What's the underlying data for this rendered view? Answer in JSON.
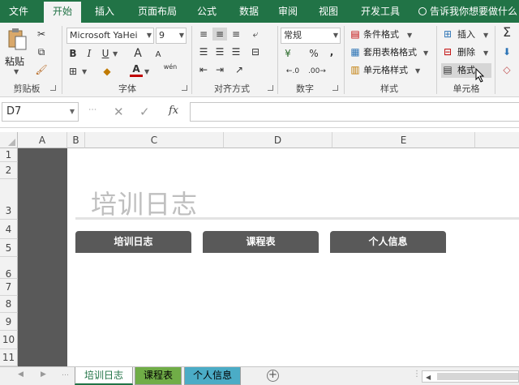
{
  "ribbon_tabs": [
    "文件",
    "开始",
    "插入",
    "页面布局",
    "公式",
    "数据",
    "审阅",
    "视图",
    "开发工具"
  ],
  "tell_me": "告诉我你想要做什么",
  "clipboard": {
    "paste": "粘贴",
    "label": "剪贴板"
  },
  "font": {
    "name": "Microsoft YaHei",
    "size": "9",
    "bold": "B",
    "italic": "I",
    "underline": "U",
    "grow": "A",
    "shrink": "A",
    "color_a": "A",
    "wen": "wén",
    "label": "字体"
  },
  "alignment": {
    "label": "对齐方式"
  },
  "number": {
    "format": "常规",
    "percent": "%",
    "comma": ",",
    "label": "数字"
  },
  "styles": {
    "conditional": "条件格式",
    "table": "套用表格格式",
    "cell_styles": "单元格样式",
    "label": "样式"
  },
  "cells": {
    "insert": "插入",
    "delete": "删除",
    "format": "格式",
    "label": "单元格"
  },
  "editing": {
    "sigma": "Σ"
  },
  "formula_bar": {
    "name_box": "D7",
    "fx": "fx",
    "cancel": "✕",
    "confirm": "✓",
    "value": ""
  },
  "columns": [
    "A",
    "B",
    "C",
    "D",
    "E"
  ],
  "rows": [
    "1",
    "2",
    "3",
    "4",
    "5",
    "6",
    "7",
    "8",
    "9",
    "10",
    "11"
  ],
  "sheet": {
    "title": "培训日志",
    "buttons": [
      "培训日志",
      "课程表",
      "个人信息"
    ]
  },
  "sheet_tabs": [
    {
      "label": "培训日志",
      "color": "#ffffff",
      "text": "#217346"
    },
    {
      "label": "课程表",
      "color": "#70ad47",
      "text": "#000000"
    },
    {
      "label": "个人信息",
      "color": "#4bacc6",
      "text": "#000000"
    }
  ],
  "colors": {
    "brand": "#217346",
    "sidebar": "#595959"
  }
}
